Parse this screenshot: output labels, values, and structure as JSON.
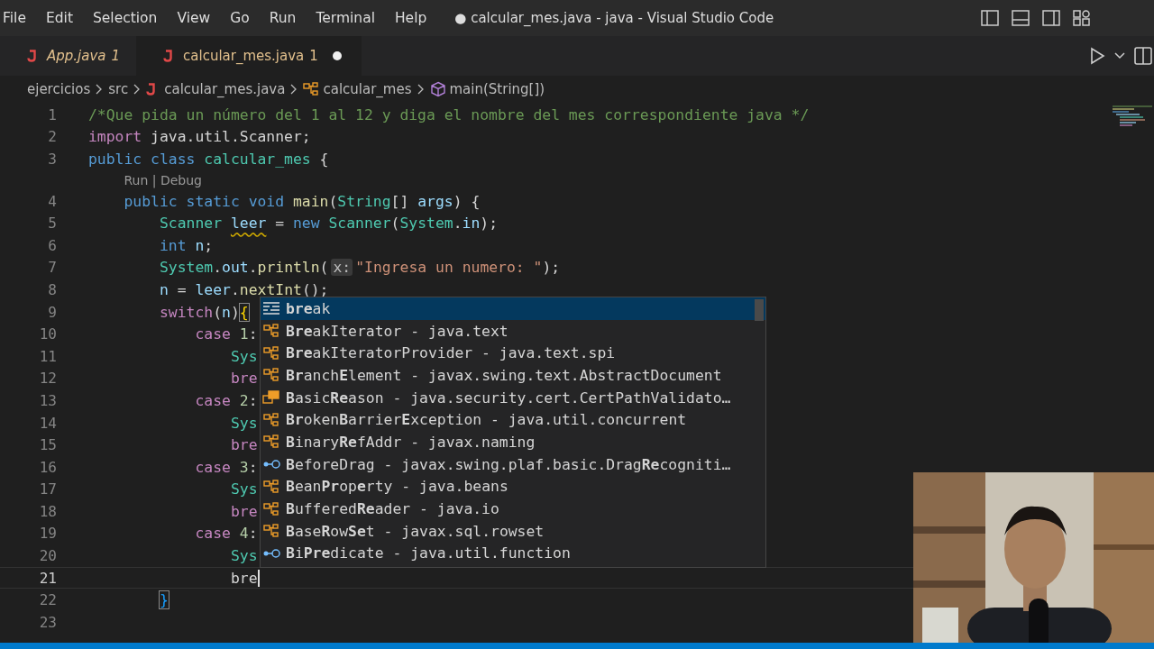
{
  "menu": [
    "File",
    "Edit",
    "Selection",
    "View",
    "Go",
    "Run",
    "Terminal",
    "Help"
  ],
  "window": {
    "title": "● calcular_mes.java - java - Visual Studio Code"
  },
  "tabs": [
    {
      "label": "App.java",
      "problems": "1",
      "preview": true,
      "selected": false,
      "modified": false
    },
    {
      "label": "calcular_mes.java",
      "problems": "1",
      "preview": false,
      "selected": true,
      "modified": true
    }
  ],
  "breadcrumbs": [
    {
      "kind": "folder",
      "label": "ejercicios"
    },
    {
      "kind": "folder",
      "label": "src"
    },
    {
      "kind": "java-file",
      "label": "calcular_mes.java"
    },
    {
      "kind": "class",
      "label": "calcular_mes"
    },
    {
      "kind": "method",
      "label": "main(String[])"
    }
  ],
  "lines": [
    {
      "kind": "code",
      "number": "1",
      "current": false,
      "tokens": [
        {
          "kind": "comment",
          "text": "/*Que pida un número del 1 al 12 y diga el nombre del mes correspondiente java */"
        }
      ]
    },
    {
      "kind": "code",
      "number": "2",
      "current": false,
      "tokens": [
        {
          "kind": "control",
          "text": "import"
        },
        {
          "kind": "plain",
          "text": " java.util.Scanner;"
        }
      ]
    },
    {
      "kind": "code",
      "number": "3",
      "current": false,
      "tokens": [
        {
          "kind": "keyword",
          "text": "public class "
        },
        {
          "kind": "type",
          "text": "calcular_mes"
        },
        {
          "kind": "plain",
          "text": " {"
        }
      ]
    },
    {
      "kind": "codelens",
      "text": "    Run | Debug"
    },
    {
      "kind": "code",
      "number": "4",
      "current": false,
      "tokens": [
        {
          "kind": "keyword",
          "text": "    public static void "
        },
        {
          "kind": "function",
          "text": "main"
        },
        {
          "kind": "plain",
          "text": "("
        },
        {
          "kind": "type",
          "text": "String"
        },
        {
          "kind": "plain",
          "text": "[] "
        },
        {
          "kind": "variable",
          "text": "args"
        },
        {
          "kind": "plain",
          "text": ") {"
        }
      ]
    },
    {
      "kind": "code",
      "number": "5",
      "current": false,
      "tokens": [
        {
          "kind": "type",
          "text": "        Scanner "
        },
        {
          "kind": "warning",
          "text": "leer"
        },
        {
          "kind": "plain",
          "text": " = "
        },
        {
          "kind": "keyword",
          "text": "new "
        },
        {
          "kind": "type",
          "text": "Scanner"
        },
        {
          "kind": "plain",
          "text": "("
        },
        {
          "kind": "type",
          "text": "System"
        },
        {
          "kind": "plain",
          "text": "."
        },
        {
          "kind": "variable",
          "text": "in"
        },
        {
          "kind": "plain",
          "text": ");"
        }
      ]
    },
    {
      "kind": "code",
      "number": "6",
      "current": false,
      "tokens": [
        {
          "kind": "keyword",
          "text": "        int "
        },
        {
          "kind": "variable",
          "text": "n"
        },
        {
          "kind": "plain",
          "text": ";"
        }
      ]
    },
    {
      "kind": "code",
      "number": "7",
      "current": false,
      "tokens": [
        {
          "kind": "type",
          "text": "        System"
        },
        {
          "kind": "plain",
          "text": "."
        },
        {
          "kind": "variable",
          "text": "out"
        },
        {
          "kind": "plain",
          "text": "."
        },
        {
          "kind": "function",
          "text": "println"
        },
        {
          "kind": "plain",
          "text": "("
        },
        {
          "kind": "hint",
          "text": "x:"
        },
        {
          "kind": "string",
          "text": "\"Ingresa un numero: \""
        },
        {
          "kind": "plain",
          "text": ");"
        }
      ]
    },
    {
      "kind": "code",
      "number": "8",
      "current": false,
      "tokens": [
        {
          "kind": "variable",
          "text": "        n"
        },
        {
          "kind": "plain",
          "text": " = "
        },
        {
          "kind": "variable",
          "text": "leer"
        },
        {
          "kind": "plain",
          "text": "."
        },
        {
          "kind": "function",
          "text": "nextInt"
        },
        {
          "kind": "plain",
          "text": "();"
        }
      ]
    },
    {
      "kind": "code",
      "number": "9",
      "current": false,
      "tokens": [
        {
          "kind": "control",
          "text": "        switch"
        },
        {
          "kind": "plain",
          "text": "("
        },
        {
          "kind": "variable",
          "text": "n"
        },
        {
          "kind": "plain",
          "text": ")"
        },
        {
          "kind": "bracket",
          "text": "{"
        }
      ]
    },
    {
      "kind": "code",
      "number": "10",
      "current": false,
      "tokens": [
        {
          "kind": "control",
          "text": "            case "
        },
        {
          "kind": "number",
          "text": "1"
        },
        {
          "kind": "plain",
          "text": ":"
        }
      ]
    },
    {
      "kind": "code",
      "number": "11",
      "current": false,
      "tokens": [
        {
          "kind": "type",
          "text": "                Sys"
        }
      ]
    },
    {
      "kind": "code",
      "number": "12",
      "current": false,
      "tokens": [
        {
          "kind": "control",
          "text": "                bre"
        }
      ]
    },
    {
      "kind": "code",
      "number": "13",
      "current": false,
      "tokens": [
        {
          "kind": "control",
          "text": "            case "
        },
        {
          "kind": "number",
          "text": "2"
        },
        {
          "kind": "plain",
          "text": ":"
        }
      ]
    },
    {
      "kind": "code",
      "number": "14",
      "current": false,
      "tokens": [
        {
          "kind": "type",
          "text": "                Sys"
        }
      ]
    },
    {
      "kind": "code",
      "number": "15",
      "current": false,
      "tokens": [
        {
          "kind": "control",
          "text": "                bre"
        }
      ]
    },
    {
      "kind": "code",
      "number": "16",
      "current": false,
      "tokens": [
        {
          "kind": "control",
          "text": "            case "
        },
        {
          "kind": "number",
          "text": "3"
        },
        {
          "kind": "plain",
          "text": ":"
        }
      ]
    },
    {
      "kind": "code",
      "number": "17",
      "current": false,
      "tokens": [
        {
          "kind": "type",
          "text": "                Sys"
        }
      ]
    },
    {
      "kind": "code",
      "number": "18",
      "current": false,
      "tokens": [
        {
          "kind": "control",
          "text": "                bre"
        }
      ]
    },
    {
      "kind": "code",
      "number": "19",
      "current": false,
      "tokens": [
        {
          "kind": "control",
          "text": "            case "
        },
        {
          "kind": "number",
          "text": "4"
        },
        {
          "kind": "plain",
          "text": ":"
        }
      ]
    },
    {
      "kind": "code",
      "number": "20",
      "current": false,
      "tokens": [
        {
          "kind": "type",
          "text": "                Sys"
        }
      ]
    },
    {
      "kind": "code",
      "number": "21",
      "current": true,
      "tokens": [
        {
          "kind": "plain",
          "text": "                bre"
        }
      ]
    },
    {
      "kind": "code",
      "number": "22",
      "current": false,
      "tokens": [
        {
          "kind": "bracket",
          "text": "        }"
        }
      ]
    },
    {
      "kind": "code",
      "number": "23",
      "current": false
    }
  ],
  "suggestions": [
    {
      "kind": "keyword",
      "text": "**bre**ak",
      "selected": true
    },
    {
      "kind": "class",
      "text": "**Bre**akIterator - java.text",
      "selected": false
    },
    {
      "kind": "class",
      "text": "**Bre**akIteratorProvider - java.text.spi",
      "selected": false
    },
    {
      "kind": "class",
      "text": "**Br**anch**E**lement - javax.swing.text.AbstractDocument",
      "selected": false
    },
    {
      "kind": "enum",
      "text": "**B**asic**Re**ason - java.security.cert.CertPathValidato…",
      "selected": false
    },
    {
      "kind": "class",
      "text": "**Br**oken**B**arrier**E**xception - java.util.concurrent",
      "selected": false
    },
    {
      "kind": "class",
      "text": "**B**inary**Re**fAddr - javax.naming",
      "selected": false
    },
    {
      "kind": "interface",
      "text": "**B**eforeDrag - javax.swing.plaf.basic.Drag**Re**cogniti…",
      "selected": false
    },
    {
      "kind": "class",
      "text": "**B**ean**Pr**op**e**rty - java.beans",
      "selected": false
    },
    {
      "kind": "class",
      "text": "**B**uffered**Re**ader - java.io",
      "selected": false
    },
    {
      "kind": "class",
      "text": "**B**ase**R**ow**Se**t - javax.sql.rowset",
      "selected": false
    },
    {
      "kind": "interface",
      "text": "**B**i**Pre**dicate - java.util.function",
      "selected": false
    }
  ],
  "webcam": {
    "kind": "picture"
  }
}
